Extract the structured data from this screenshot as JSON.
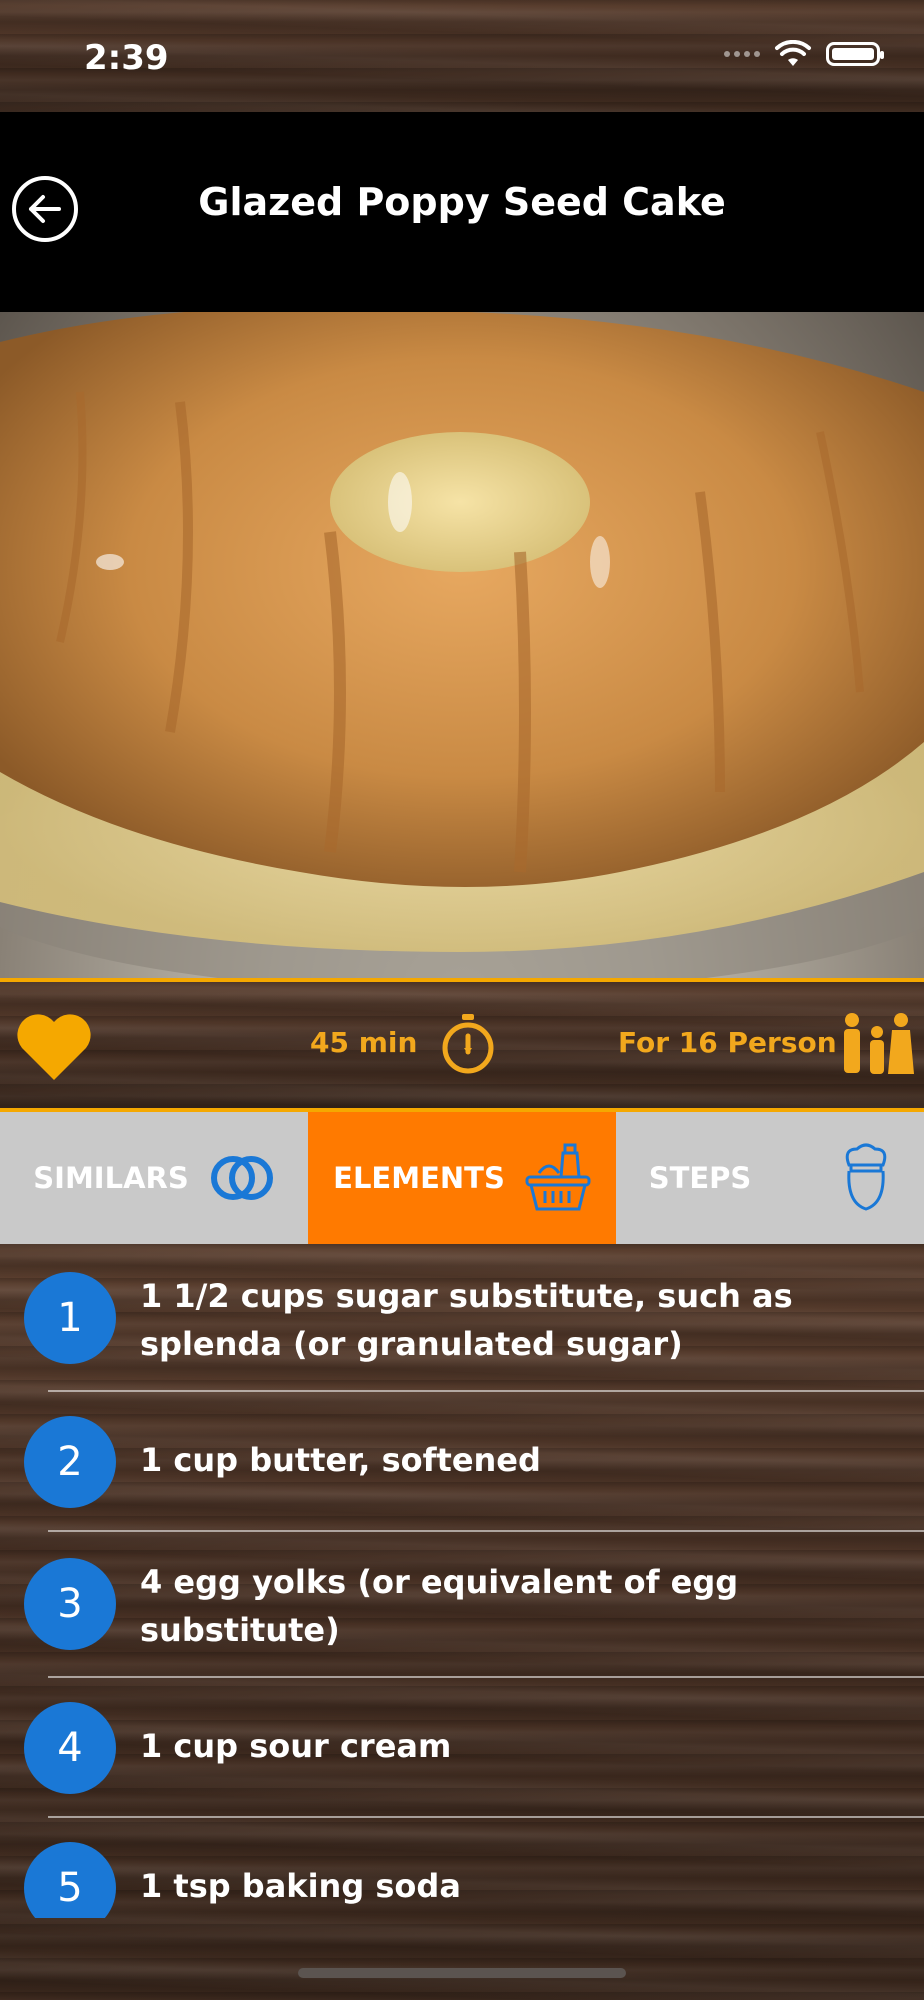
{
  "status": {
    "time": "2:39"
  },
  "header": {
    "title": "Glazed Poppy Seed Cake"
  },
  "info": {
    "time": "45 min",
    "servings": "For 16 Person"
  },
  "tabs": [
    {
      "label": "SIMILARS",
      "icon": "rings-icon"
    },
    {
      "label": "ELEMENTS",
      "icon": "basket-icon",
      "active": true
    },
    {
      "label": "STEPS",
      "icon": "chef-icon"
    }
  ],
  "ingredients": [
    {
      "num": "1",
      "text": "1 1/2 cups sugar substitute, such as splenda (or granulated sugar)"
    },
    {
      "num": "2",
      "text": "1 cup butter, softened"
    },
    {
      "num": "3",
      "text": "4 egg yolks (or equivalent of egg substitute)"
    },
    {
      "num": "4",
      "text": "1 cup sour cream"
    },
    {
      "num": "5",
      "text": "1 tsp baking soda"
    }
  ],
  "colors": {
    "accent": "#f5a800",
    "active_tab": "#ff7a00",
    "number_badge": "#1a78d6",
    "tab_bg": "#c9c9c9"
  }
}
